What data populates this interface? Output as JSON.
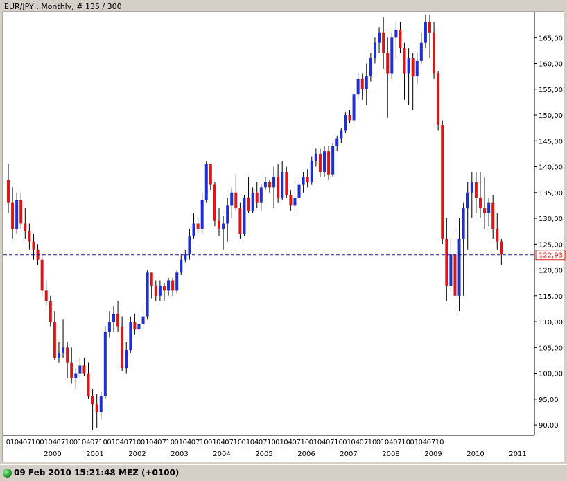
{
  "window": {
    "title": "EUR/JPY , Monthly, # 135 / 300"
  },
  "status_bar": {
    "text": "09 Feb 2010 15:21:48  MEZ (+0100)"
  },
  "colors": {
    "up": "#1f2fd6",
    "down": "#d81818",
    "wick": "#000000",
    "current_line": "#1a1aa0",
    "current_label": "#d81818",
    "background": "#ffffff"
  },
  "chart_data": {
    "type": "candlestick",
    "symbol": "EUR/JPY",
    "period": "Monthly",
    "ylim": [
      88,
      170
    ],
    "y_ticks": [
      90,
      95,
      100,
      105,
      110,
      115,
      120,
      125,
      130,
      135,
      140,
      145,
      150,
      155,
      160,
      165
    ],
    "y_tick_labels": [
      "90,00",
      "95,00",
      "100,00",
      "105,00",
      "110,00",
      "115,00",
      "120,00",
      "125,00",
      "130,00",
      "135,00",
      "140,00",
      "145,00",
      "150,00",
      "155,00",
      "160,00",
      "165,00"
    ],
    "x_month_labels": [
      "01",
      "04",
      "07",
      "10",
      "01",
      "04",
      "07",
      "10",
      "01",
      "04",
      "07",
      "10",
      "01",
      "04",
      "07",
      "10",
      "01",
      "04",
      "07",
      "10",
      "01",
      "04",
      "07",
      "10",
      "01",
      "04",
      "07",
      "10",
      "01",
      "04",
      "07",
      "10",
      "01",
      "04",
      "07",
      "10",
      "01",
      "04",
      "07",
      "10",
      "01",
      "04",
      "07",
      "10",
      "01",
      "04",
      "07",
      "10",
      "01",
      "04",
      "07",
      "10"
    ],
    "x_year_labels": [
      "2000",
      "2001",
      "2002",
      "2003",
      "2004",
      "2005",
      "2006",
      "2007",
      "2008",
      "2009",
      "2010",
      "2011"
    ],
    "current_price": 122.93,
    "current_price_label": "122,93",
    "candles": [
      {
        "o": 137.5,
        "h": 140.5,
        "l": 131.0,
        "c": 133.0
      },
      {
        "o": 133.0,
        "h": 136.0,
        "l": 126.0,
        "c": 128.0
      },
      {
        "o": 128.0,
        "h": 135.0,
        "l": 127.0,
        "c": 133.5
      },
      {
        "o": 133.5,
        "h": 135.0,
        "l": 128.0,
        "c": 129.0
      },
      {
        "o": 129.0,
        "h": 132.0,
        "l": 126.0,
        "c": 127.5
      },
      {
        "o": 127.5,
        "h": 129.0,
        "l": 124.0,
        "c": 125.5
      },
      {
        "o": 125.5,
        "h": 127.0,
        "l": 122.0,
        "c": 124.0
      },
      {
        "o": 124.0,
        "h": 125.0,
        "l": 121.0,
        "c": 122.0
      },
      {
        "o": 122.0,
        "h": 123.0,
        "l": 115.0,
        "c": 116.0
      },
      {
        "o": 116.0,
        "h": 118.0,
        "l": 113.0,
        "c": 114.0
      },
      {
        "o": 114.0,
        "h": 115.0,
        "l": 109.0,
        "c": 110.0
      },
      {
        "o": 110.0,
        "h": 112.0,
        "l": 102.5,
        "c": 103.0
      },
      {
        "o": 103.0,
        "h": 106.0,
        "l": 102.0,
        "c": 104.0
      },
      {
        "o": 104.0,
        "h": 110.5,
        "l": 103.0,
        "c": 105.0
      },
      {
        "o": 105.0,
        "h": 106.0,
        "l": 99.0,
        "c": 102.0
      },
      {
        "o": 102.0,
        "h": 105.0,
        "l": 98.0,
        "c": 99.0
      },
      {
        "o": 99.0,
        "h": 101.0,
        "l": 97.0,
        "c": 100.0
      },
      {
        "o": 100.0,
        "h": 103.0,
        "l": 99.0,
        "c": 101.5
      },
      {
        "o": 101.5,
        "h": 103.0,
        "l": 99.5,
        "c": 100.0
      },
      {
        "o": 100.0,
        "h": 102.0,
        "l": 95.0,
        "c": 95.5
      },
      {
        "o": 95.5,
        "h": 97.0,
        "l": 89.0,
        "c": 94.0
      },
      {
        "o": 94.0,
        "h": 96.0,
        "l": 89.5,
        "c": 92.5
      },
      {
        "o": 92.5,
        "h": 96.5,
        "l": 91.0,
        "c": 95.5
      },
      {
        "o": 95.5,
        "h": 109.0,
        "l": 95.0,
        "c": 108.0
      },
      {
        "o": 108.0,
        "h": 112.0,
        "l": 107.0,
        "c": 110.0
      },
      {
        "o": 110.0,
        "h": 113.0,
        "l": 108.0,
        "c": 111.5
      },
      {
        "o": 111.5,
        "h": 114.0,
        "l": 108.0,
        "c": 109.0
      },
      {
        "o": 109.0,
        "h": 111.0,
        "l": 100.5,
        "c": 101.0
      },
      {
        "o": 101.0,
        "h": 106.0,
        "l": 100.0,
        "c": 104.5
      },
      {
        "o": 104.5,
        "h": 111.0,
        "l": 104.0,
        "c": 110.0
      },
      {
        "o": 110.0,
        "h": 111.5,
        "l": 107.5,
        "c": 108.5
      },
      {
        "o": 108.5,
        "h": 111.0,
        "l": 107.0,
        "c": 109.5
      },
      {
        "o": 109.5,
        "h": 112.5,
        "l": 108.5,
        "c": 111.0
      },
      {
        "o": 111.0,
        "h": 120.0,
        "l": 110.5,
        "c": 119.5
      },
      {
        "o": 119.5,
        "h": 119.5,
        "l": 114.5,
        "c": 117.0
      },
      {
        "o": 117.0,
        "h": 118.0,
        "l": 114.0,
        "c": 115.0
      },
      {
        "o": 115.0,
        "h": 118.0,
        "l": 114.0,
        "c": 117.0
      },
      {
        "o": 117.0,
        "h": 117.5,
        "l": 114.0,
        "c": 116.0
      },
      {
        "o": 116.0,
        "h": 118.5,
        "l": 115.0,
        "c": 118.0
      },
      {
        "o": 118.0,
        "h": 118.5,
        "l": 115.0,
        "c": 116.0
      },
      {
        "o": 116.0,
        "h": 120.0,
        "l": 115.5,
        "c": 119.5
      },
      {
        "o": 119.5,
        "h": 123.0,
        "l": 119.0,
        "c": 122.0
      },
      {
        "o": 122.0,
        "h": 124.0,
        "l": 121.5,
        "c": 123.0
      },
      {
        "o": 123.0,
        "h": 128.0,
        "l": 122.0,
        "c": 126.5
      },
      {
        "o": 126.5,
        "h": 131.0,
        "l": 126.0,
        "c": 129.0
      },
      {
        "o": 129.0,
        "h": 130.0,
        "l": 127.0,
        "c": 128.0
      },
      {
        "o": 128.0,
        "h": 135.0,
        "l": 127.0,
        "c": 133.5
      },
      {
        "o": 133.5,
        "h": 141.0,
        "l": 133.0,
        "c": 140.5
      },
      {
        "o": 140.5,
        "h": 140.5,
        "l": 135.5,
        "c": 136.5
      },
      {
        "o": 136.5,
        "h": 137.0,
        "l": 128.5,
        "c": 129.5
      },
      {
        "o": 129.5,
        "h": 132.0,
        "l": 126.5,
        "c": 128.0
      },
      {
        "o": 128.0,
        "h": 130.5,
        "l": 124.0,
        "c": 129.0
      },
      {
        "o": 129.0,
        "h": 134.0,
        "l": 125.5,
        "c": 132.5
      },
      {
        "o": 132.5,
        "h": 136.0,
        "l": 130.0,
        "c": 135.0
      },
      {
        "o": 135.0,
        "h": 138.5,
        "l": 131.5,
        "c": 132.0
      },
      {
        "o": 132.0,
        "h": 133.0,
        "l": 126.0,
        "c": 127.0
      },
      {
        "o": 127.0,
        "h": 134.5,
        "l": 126.5,
        "c": 134.0
      },
      {
        "o": 134.0,
        "h": 138.0,
        "l": 131.0,
        "c": 131.5
      },
      {
        "o": 131.5,
        "h": 136.0,
        "l": 131.0,
        "c": 135.0
      },
      {
        "o": 135.0,
        "h": 137.0,
        "l": 132.0,
        "c": 133.0
      },
      {
        "o": 133.0,
        "h": 136.5,
        "l": 131.5,
        "c": 136.0
      },
      {
        "o": 136.0,
        "h": 138.0,
        "l": 135.5,
        "c": 137.0
      },
      {
        "o": 137.0,
        "h": 137.5,
        "l": 135.0,
        "c": 136.0
      },
      {
        "o": 136.0,
        "h": 140.0,
        "l": 132.0,
        "c": 138.0
      },
      {
        "o": 138.0,
        "h": 140.5,
        "l": 133.0,
        "c": 134.0
      },
      {
        "o": 134.0,
        "h": 141.0,
        "l": 133.5,
        "c": 139.0
      },
      {
        "o": 139.0,
        "h": 140.0,
        "l": 134.0,
        "c": 134.5
      },
      {
        "o": 134.5,
        "h": 135.5,
        "l": 131.5,
        "c": 132.5
      },
      {
        "o": 132.5,
        "h": 137.0,
        "l": 130.5,
        "c": 134.0
      },
      {
        "o": 134.0,
        "h": 137.5,
        "l": 133.0,
        "c": 136.5
      },
      {
        "o": 136.5,
        "h": 139.0,
        "l": 135.0,
        "c": 138.0
      },
      {
        "o": 138.0,
        "h": 139.5,
        "l": 136.0,
        "c": 137.0
      },
      {
        "o": 137.0,
        "h": 142.0,
        "l": 136.5,
        "c": 141.0
      },
      {
        "o": 141.0,
        "h": 143.5,
        "l": 140.0,
        "c": 142.5
      },
      {
        "o": 142.5,
        "h": 143.5,
        "l": 138.0,
        "c": 139.0
      },
      {
        "o": 139.0,
        "h": 144.0,
        "l": 138.0,
        "c": 143.0
      },
      {
        "o": 143.0,
        "h": 144.0,
        "l": 137.5,
        "c": 138.5
      },
      {
        "o": 138.5,
        "h": 144.5,
        "l": 138.0,
        "c": 144.0
      },
      {
        "o": 144.0,
        "h": 146.0,
        "l": 143.0,
        "c": 145.5
      },
      {
        "o": 145.5,
        "h": 147.5,
        "l": 144.5,
        "c": 147.0
      },
      {
        "o": 147.0,
        "h": 150.5,
        "l": 146.5,
        "c": 150.0
      },
      {
        "o": 150.0,
        "h": 151.0,
        "l": 148.5,
        "c": 149.0
      },
      {
        "o": 149.0,
        "h": 155.0,
        "l": 148.5,
        "c": 154.0
      },
      {
        "o": 154.0,
        "h": 158.0,
        "l": 153.0,
        "c": 157.0
      },
      {
        "o": 157.0,
        "h": 158.0,
        "l": 153.0,
        "c": 155.0
      },
      {
        "o": 155.0,
        "h": 160.0,
        "l": 152.0,
        "c": 157.5
      },
      {
        "o": 157.5,
        "h": 162.0,
        "l": 156.5,
        "c": 161.0
      },
      {
        "o": 161.0,
        "h": 165.0,
        "l": 160.0,
        "c": 164.0
      },
      {
        "o": 164.0,
        "h": 167.0,
        "l": 162.0,
        "c": 166.0
      },
      {
        "o": 166.0,
        "h": 169.0,
        "l": 159.0,
        "c": 162.0
      },
      {
        "o": 162.0,
        "h": 165.0,
        "l": 149.5,
        "c": 158.0
      },
      {
        "o": 158.0,
        "h": 166.0,
        "l": 157.0,
        "c": 165.0
      },
      {
        "o": 165.0,
        "h": 168.0,
        "l": 161.0,
        "c": 166.5
      },
      {
        "o": 166.5,
        "h": 168.0,
        "l": 162.0,
        "c": 163.0
      },
      {
        "o": 163.0,
        "h": 164.0,
        "l": 153.0,
        "c": 158.0
      },
      {
        "o": 158.0,
        "h": 163.0,
        "l": 152.0,
        "c": 161.0
      },
      {
        "o": 161.0,
        "h": 162.0,
        "l": 151.0,
        "c": 157.5
      },
      {
        "o": 157.5,
        "h": 162.0,
        "l": 156.0,
        "c": 160.5
      },
      {
        "o": 160.5,
        "h": 166.0,
        "l": 160.0,
        "c": 164.0
      },
      {
        "o": 164.0,
        "h": 169.5,
        "l": 163.0,
        "c": 168.0
      },
      {
        "o": 168.0,
        "h": 169.5,
        "l": 161.0,
        "c": 166.0
      },
      {
        "o": 166.0,
        "h": 168.0,
        "l": 157.0,
        "c": 158.0
      },
      {
        "o": 158.0,
        "h": 158.5,
        "l": 147.0,
        "c": 148.0
      },
      {
        "o": 148.0,
        "h": 149.0,
        "l": 125.0,
        "c": 126.0
      },
      {
        "o": 126.0,
        "h": 130.0,
        "l": 114.0,
        "c": 117.0
      },
      {
        "o": 117.0,
        "h": 126.0,
        "l": 116.0,
        "c": 123.0
      },
      {
        "o": 123.0,
        "h": 128.0,
        "l": 113.0,
        "c": 115.0
      },
      {
        "o": 115.0,
        "h": 130.0,
        "l": 112.0,
        "c": 126.0
      },
      {
        "o": 126.0,
        "h": 133.0,
        "l": 115.0,
        "c": 132.0
      },
      {
        "o": 132.0,
        "h": 137.0,
        "l": 124.0,
        "c": 135.0
      },
      {
        "o": 135.0,
        "h": 139.0,
        "l": 130.0,
        "c": 137.0
      },
      {
        "o": 137.0,
        "h": 139.0,
        "l": 131.0,
        "c": 134.0
      },
      {
        "o": 134.0,
        "h": 139.0,
        "l": 130.0,
        "c": 132.0
      },
      {
        "o": 132.0,
        "h": 138.0,
        "l": 128.0,
        "c": 131.0
      },
      {
        "o": 131.0,
        "h": 134.0,
        "l": 128.5,
        "c": 133.0
      },
      {
        "o": 133.0,
        "h": 134.5,
        "l": 126.0,
        "c": 128.0
      },
      {
        "o": 128.0,
        "h": 131.0,
        "l": 124.0,
        "c": 125.5
      },
      {
        "o": 125.5,
        "h": 126.0,
        "l": 121.0,
        "c": 123.0
      }
    ]
  }
}
